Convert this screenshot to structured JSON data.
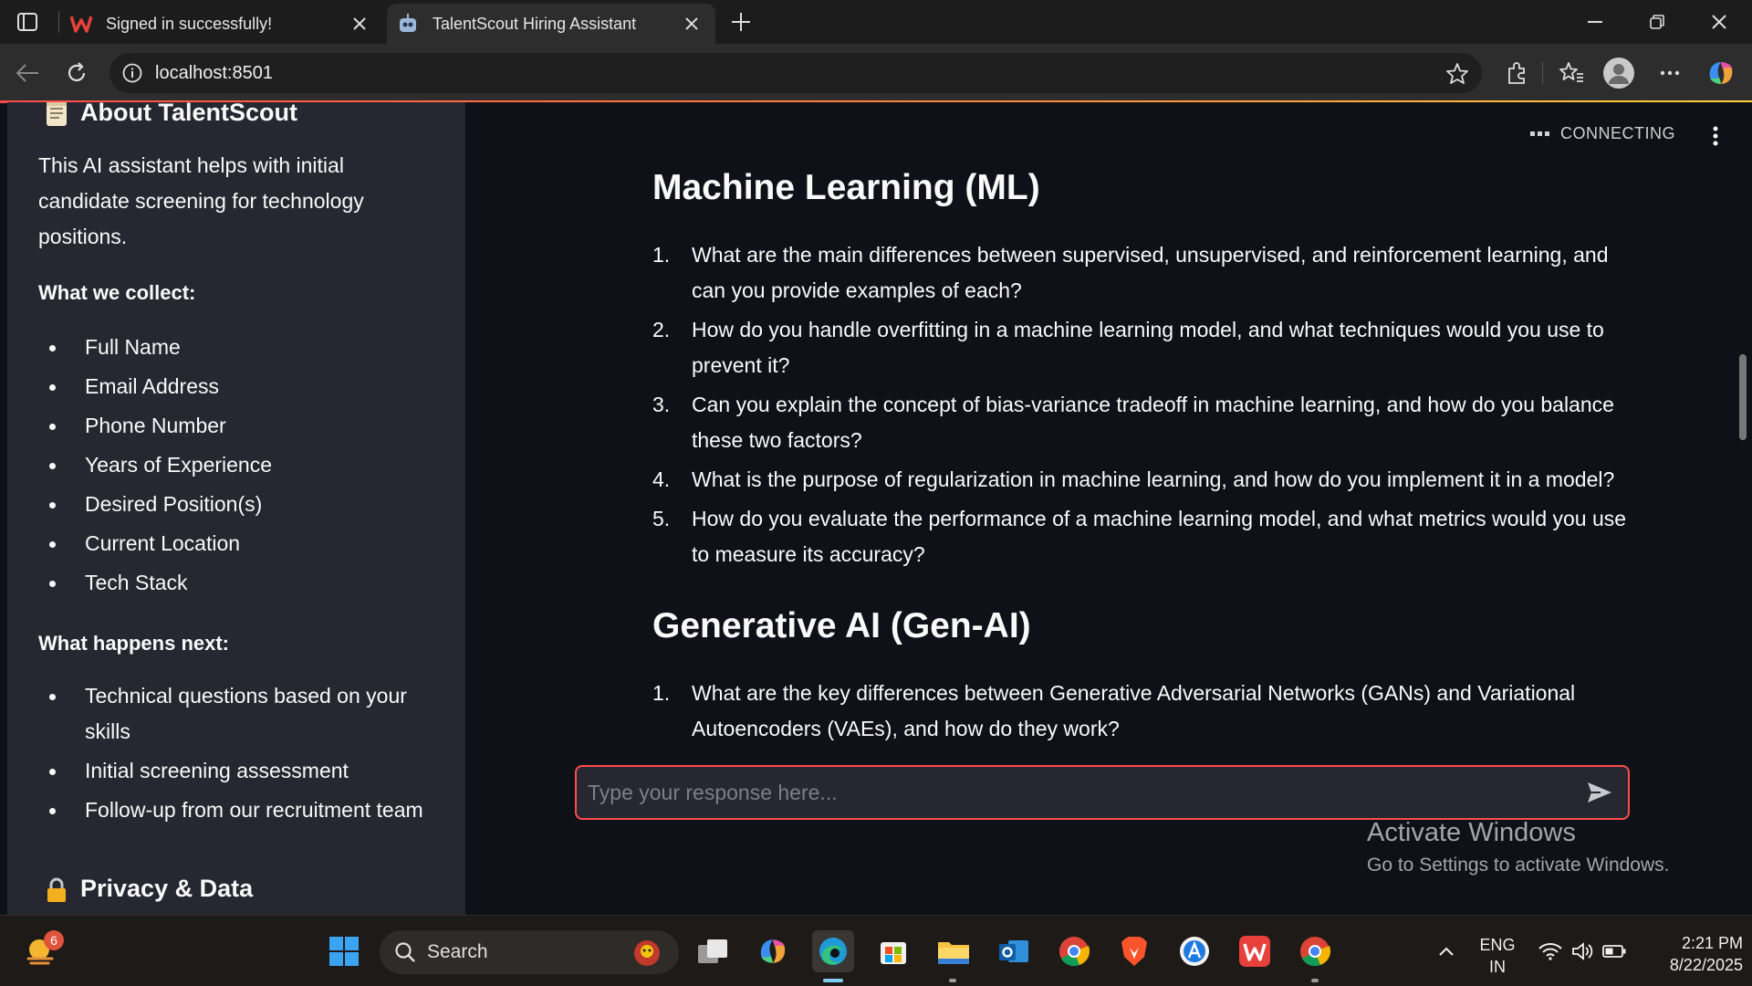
{
  "browser": {
    "tabs": [
      {
        "title": "Signed in successfully!",
        "active": false
      },
      {
        "title": "TalentScout Hiring Assistant",
        "active": true
      }
    ],
    "url": "localhost:8501"
  },
  "sidebar": {
    "about_heading": "About TalentScout",
    "intro": "This AI assistant helps with initial candidate screening for technology positions.",
    "collect_heading": "What we collect:",
    "collect_items": [
      "Full Name",
      "Email Address",
      "Phone Number",
      "Years of Experience",
      "Desired Position(s)",
      "Current Location",
      "Tech Stack"
    ],
    "next_heading": "What happens next:",
    "next_items": [
      "Technical questions based on your skills",
      "Initial screening assessment",
      "Follow-up from our recruitment team"
    ],
    "privacy_heading": "Privacy & Data"
  },
  "main": {
    "status": "CONNECTING",
    "sections": [
      {
        "heading": "Machine Learning (ML)",
        "questions": [
          "What are the main differences between supervised, unsupervised, and reinforcement learning, and can you provide examples of each?",
          "How do you handle overfitting in a machine learning model, and what techniques would you use to prevent it?",
          "Can you explain the concept of bias-variance tradeoff in machine learning, and how do you balance these two factors?",
          "What is the purpose of regularization in machine learning, and how do you implement it in a model?",
          "How do you evaluate the performance of a machine learning model, and what metrics would you use to measure its accuracy?"
        ]
      },
      {
        "heading": "Generative AI (Gen-AI)",
        "questions": [
          "What are the key differences between Generative Adversarial Networks (GANs) and Variational Autoencoders (VAEs), and how do they work?"
        ]
      }
    ],
    "chat_placeholder": "Type your response here...",
    "watermark_title": "Activate Windows",
    "watermark_sub": "Go to Settings to activate Windows."
  },
  "taskbar": {
    "search_label": "Search",
    "weather_badge": "6",
    "language": "ENG",
    "region": "IN",
    "time": "2:21 PM",
    "date": "8/22/2025"
  },
  "colors": {
    "accent": "#ff4b4b",
    "sidebar_bg": "#262730",
    "main_bg": "#0e1117"
  }
}
